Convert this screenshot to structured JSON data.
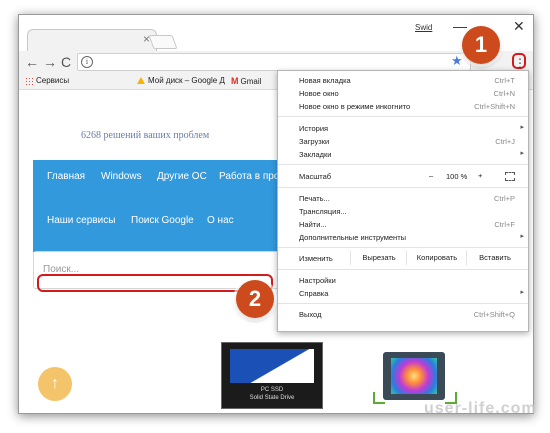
{
  "browser": {
    "profile_label": "Swid",
    "window_controls": {
      "minimize": "—",
      "close": "✕"
    },
    "nav": {
      "back": "←",
      "forward": "→",
      "reload": "C"
    },
    "omnibox_value": "",
    "menu_glyph": "⋮"
  },
  "bookmarks": [
    {
      "label": "Сервисы",
      "icon": "apps-icon"
    },
    {
      "label": "Мой диск – Google Д",
      "icon": "google-drive-icon"
    },
    {
      "label": "Gmail",
      "icon": "gmail-icon"
    }
  ],
  "page": {
    "site_title": "6268 решений ваших проблем",
    "nav_items": [
      "Главная",
      "Windows",
      "Другие ОС",
      "Работа в про",
      "Наши сервисы",
      "Поиск Google",
      "О нас"
    ],
    "search_placeholder": "Поиск...",
    "ssd_label_1": "PC SSD",
    "ssd_label_2": "Solid State Drive",
    "scroll_top_glyph": "↑"
  },
  "menu": {
    "new_tab": {
      "label": "Новая вкладка",
      "shortcut": "Ctrl+T"
    },
    "new_window": {
      "label": "Новое окно",
      "shortcut": "Ctrl+N"
    },
    "incognito": {
      "label": "Новое окно в режиме инкогнито",
      "shortcut": "Ctrl+Shift+N"
    },
    "history": {
      "label": "История"
    },
    "downloads": {
      "label": "Загрузки",
      "shortcut": "Ctrl+J"
    },
    "bookmarks": {
      "label": "Закладки"
    },
    "zoom": {
      "label": "Масштаб",
      "minus": "–",
      "value": "100 %",
      "plus": "+"
    },
    "print": {
      "label": "Печать...",
      "shortcut": "Ctrl+P"
    },
    "cast": {
      "label": "Трансляция..."
    },
    "find": {
      "label": "Найти...",
      "shortcut": "Ctrl+F"
    },
    "more_tools": {
      "label": "Дополнительные инструменты"
    },
    "edit": {
      "label": "Изменить",
      "cut": "Вырезать",
      "copy": "Копировать",
      "paste": "Вставить"
    },
    "settings": {
      "label": "Настройки"
    },
    "help": {
      "label": "Справка"
    },
    "exit": {
      "label": "Выход",
      "shortcut": "Ctrl+Shift+Q"
    },
    "arrow": "▸"
  },
  "annotations": {
    "step1": "1",
    "step2": "2"
  },
  "watermark": "user-life.com",
  "colors": {
    "accent_red": "#d21b1b",
    "badge": "#cc4a1b",
    "nav_blue": "#3399dd"
  }
}
